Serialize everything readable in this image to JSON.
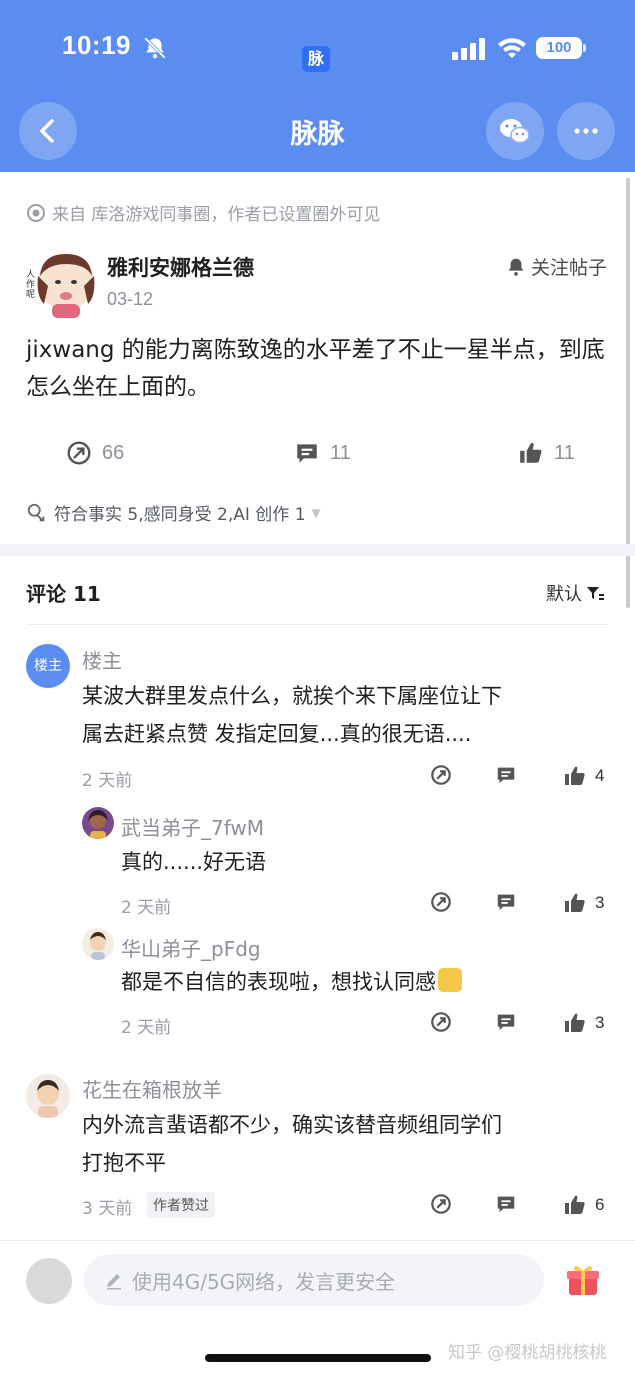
{
  "status_bar": {
    "time": "10:19",
    "app_badge": "脉",
    "battery": "100"
  },
  "nav": {
    "title": "脉脉"
  },
  "post": {
    "source": "来自 库洛游戏同事圈，作者已设置圈外可见",
    "author": "雅利安娜格兰德",
    "date": "03-12",
    "follow_label": "关注帖子",
    "body": "jixwang 的能力离陈致逸的水平差了不止一星半点，到底怎么坐在上面的。",
    "share_count": "66",
    "comment_count": "11",
    "like_count": "11",
    "tags": "符合事实 5,感同身受 2,AI 创作 1",
    "avatar_caption": "人 作 呢"
  },
  "comments_section": {
    "title": "评论 11",
    "sort_label": "默认"
  },
  "comments": [
    {
      "name": "楼主",
      "avatar_label": "楼主",
      "text_line1": "某波大群里发点什么，就挨个来下属座位让下",
      "text_line2": "属去赶紧点赞 发指定回复...真的很无语....",
      "time": "2 天前",
      "likes": "4"
    },
    {
      "name": "武当弟子_7fwM",
      "text_line1": "真的......好无语",
      "time": "2 天前",
      "likes": "3"
    },
    {
      "name": "华山弟子_pFdg",
      "text_line1": "都是不自信的表现啦，想找认同感",
      "time": "2 天前",
      "likes": "3"
    },
    {
      "name": "花生在箱根放羊",
      "text_line1": "内外流言蜚语都不少，确实该替音频组同学们",
      "text_line2": "打抱不平",
      "time": "3 天前",
      "badge": "作者赞过",
      "likes": "6"
    }
  ],
  "bottom": {
    "placeholder": "使用4G/5G网络，发言更安全",
    "watermark": "知乎 @樱桃胡桃核桃"
  },
  "colors": {
    "brand_blue": "#5b8df0",
    "text_gray": "#8d9099"
  },
  "icons": [
    "bell-off-icon",
    "signal-icon",
    "wifi-icon",
    "back-icon",
    "wechat-icon",
    "more-icon",
    "eye-icon",
    "bell-icon",
    "share-icon",
    "comment-icon",
    "like-icon",
    "filter-icon",
    "pen-icon",
    "gift-icon"
  ]
}
